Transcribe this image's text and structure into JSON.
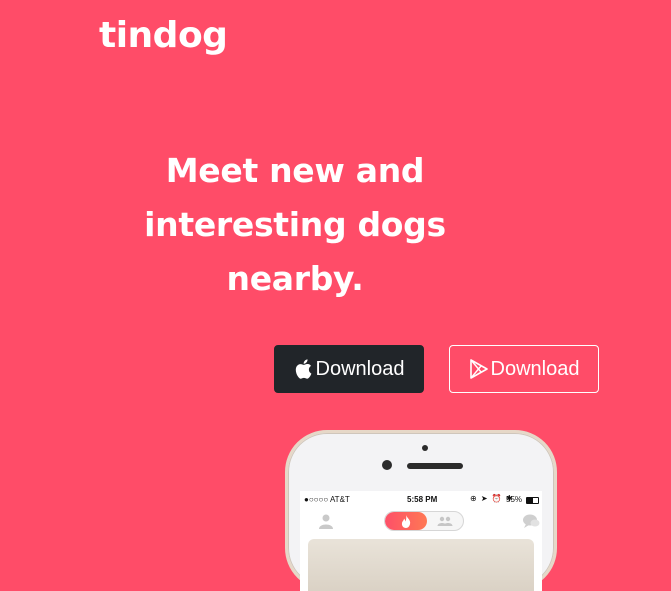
{
  "brand": {
    "name": "tindog"
  },
  "hero": {
    "headline": "Meet new and interesting dogs nearby."
  },
  "buttons": {
    "apple": {
      "label": "Download",
      "icon": "apple-icon"
    },
    "google_play": {
      "label": "Download",
      "icon": "google-play-icon"
    }
  },
  "phone": {
    "status": {
      "carrier": "●○○○○ AT&T",
      "time": "5:58 PM",
      "battery": "55%"
    }
  },
  "colors": {
    "background": "#ff4c68",
    "dark_button": "#212529",
    "text": "#ffffff"
  }
}
